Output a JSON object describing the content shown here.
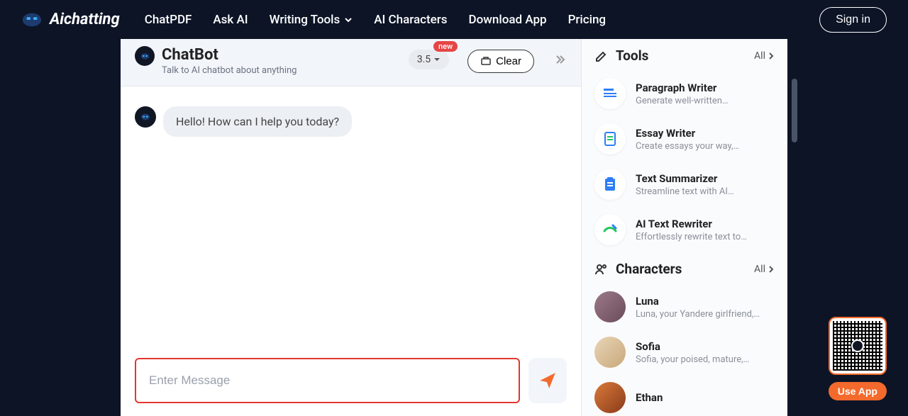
{
  "brand": {
    "name": "Aichatting"
  },
  "nav": {
    "items": [
      {
        "label": "ChatPDF"
      },
      {
        "label": "Ask AI"
      },
      {
        "label": "Writing Tools",
        "has_dropdown": true
      },
      {
        "label": "AI Characters"
      },
      {
        "label": "Download App"
      },
      {
        "label": "Pricing"
      }
    ],
    "signin": "Sign in"
  },
  "chat": {
    "title": "ChatBot",
    "subtitle": "Talk to AI chatbot about anything",
    "model": "3.5",
    "model_badge": "new",
    "clear_label": "Clear",
    "messages": [
      {
        "role": "assistant",
        "text": "Hello! How can I help you today?"
      }
    ],
    "input_placeholder": "Enter Message"
  },
  "sidebar": {
    "tools": {
      "heading": "Tools",
      "all_label": "All",
      "items": [
        {
          "title": "Paragraph Writer",
          "desc": "Generate well-written…"
        },
        {
          "title": "Essay Writer",
          "desc": "Create essays your way,…"
        },
        {
          "title": "Text Summarizer",
          "desc": "Streamline text with AI…"
        },
        {
          "title": "AI Text Rewriter",
          "desc": "Effortlessly rewrite text to…"
        }
      ]
    },
    "characters": {
      "heading": "Characters",
      "all_label": "All",
      "items": [
        {
          "title": "Luna",
          "desc": "Luna, your Yandere girlfriend,…"
        },
        {
          "title": "Sofia",
          "desc": "Sofia, your poised, mature,…"
        },
        {
          "title": "Ethan",
          "desc": ""
        }
      ]
    }
  },
  "qr": {
    "button_label": "Use App"
  }
}
